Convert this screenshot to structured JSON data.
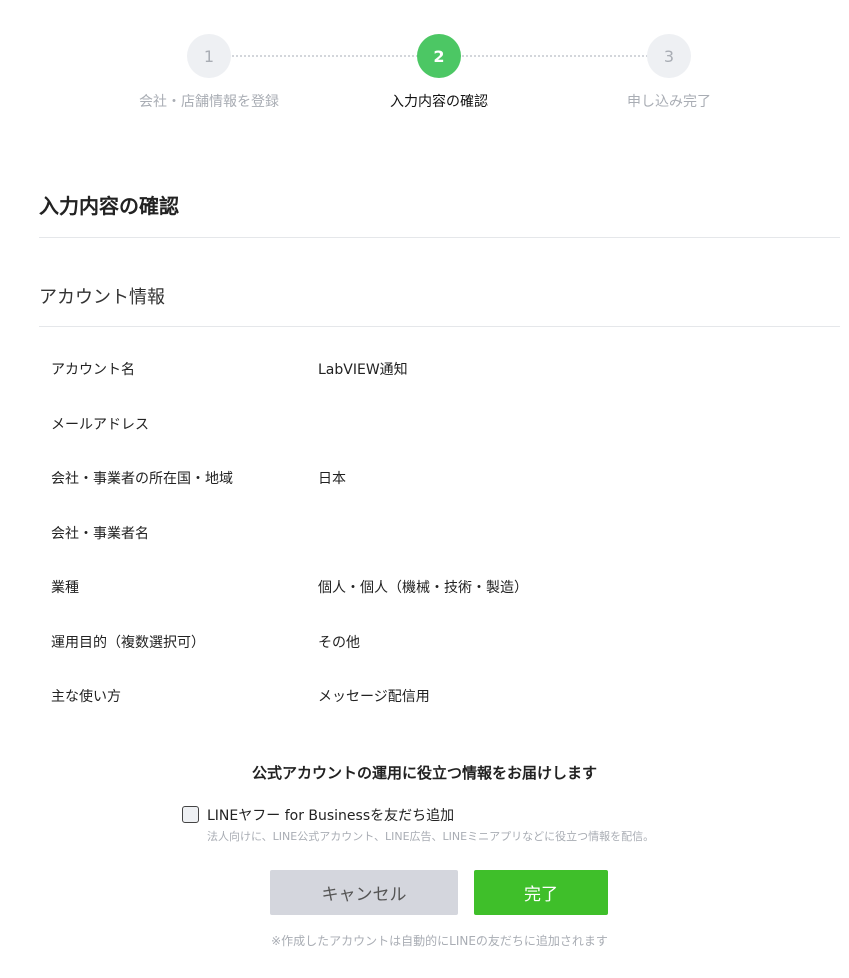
{
  "stepper": {
    "steps": [
      {
        "number": "1",
        "label": "会社・店舗情報を登録",
        "state": "inactive"
      },
      {
        "number": "2",
        "label": "入力内容の確認",
        "state": "active"
      },
      {
        "number": "3",
        "label": "申し込み完了",
        "state": "inactive"
      }
    ]
  },
  "page": {
    "title": "入力内容の確認",
    "section_title": "アカウント情報"
  },
  "info": [
    {
      "label": "アカウント名",
      "value": "LabVIEW通知"
    },
    {
      "label": "メールアドレス",
      "value": ""
    },
    {
      "label": "会社・事業者の所在国・地域",
      "value": "日本"
    },
    {
      "label": "会社・事業者名",
      "value": ""
    },
    {
      "label": "業種",
      "value": "個人・個人（機械・技術・製造）"
    },
    {
      "label": "運用目的（複数選択可）",
      "value": "その他"
    },
    {
      "label": "主な使い方",
      "value": "メッセージ配信用"
    }
  ],
  "optin": {
    "title": "公式アカウントの運用に役立つ情報をお届けします",
    "checkbox_label": "LINEヤフー for Businessを友だち追加",
    "checkbox_checked": false,
    "checkbox_description": "法人向けに、LINE公式アカウント、LINE広告、LINEミニアプリなどに役立つ情報を配信。"
  },
  "actions": {
    "cancel_label": "キャンセル",
    "done_label": "完了"
  },
  "footnote": "※作成したアカウントは自動的にLINEの友だちに追加されます",
  "colors": {
    "accent_green": "#4cc764",
    "done_button": "#3fbf2a",
    "cancel_button": "#d4d6dd"
  }
}
